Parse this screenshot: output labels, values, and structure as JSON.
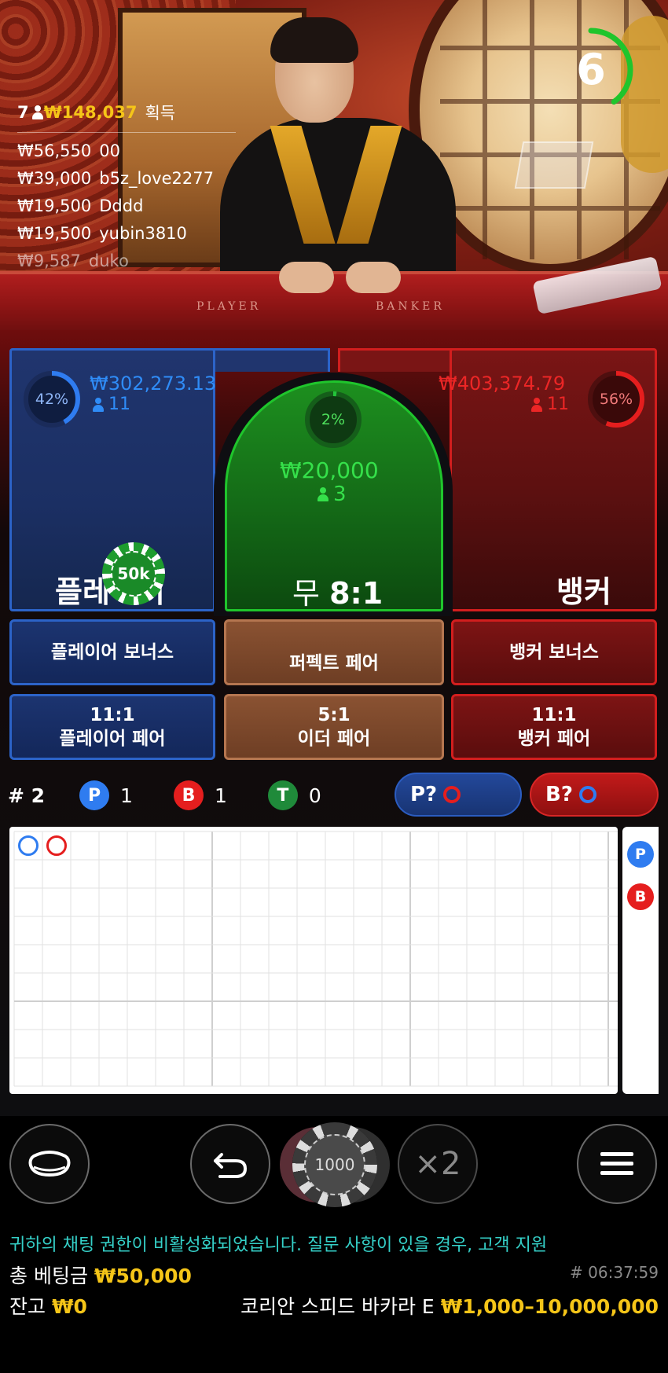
{
  "winners": {
    "count": "7",
    "total": "₩148,037",
    "suffix": "획득",
    "rows": [
      {
        "amount": "₩56,550",
        "name": "00"
      },
      {
        "amount": "₩39,000",
        "name": "b5z_love2277"
      },
      {
        "amount": "₩19,500",
        "name": "Dddd"
      },
      {
        "amount": "₩19,500",
        "name": "yubin3810"
      },
      {
        "amount": "₩9,587",
        "name": "duko"
      }
    ]
  },
  "timer": {
    "value": "6",
    "progress": 0.4
  },
  "table_labels": {
    "player": "PLAYER",
    "banker": "BANKER"
  },
  "bets": {
    "player": {
      "percent": "42%",
      "percent_value": 0.42,
      "amount": "₩302,273.13",
      "count": "11",
      "label": "플레이어"
    },
    "tie": {
      "percent": "2%",
      "percent_value": 0.02,
      "amount": "₩20,000",
      "count": "3",
      "label": "무",
      "odds": "8:1"
    },
    "banker": {
      "percent": "56%",
      "percent_value": 0.56,
      "amount": "₩403,374.79",
      "count": "11",
      "label": "뱅커"
    }
  },
  "placed_chip": "50k",
  "side_bets": {
    "player_bonus": "플레이어 보너스",
    "perfect_pair": "퍼펙트 페어",
    "banker_bonus": "뱅커 보너스",
    "player_pair": {
      "odds": "11:1",
      "label": "플레이어 페어"
    },
    "either_pair": {
      "odds": "5:1",
      "label": "이더 페어"
    },
    "banker_pair": {
      "odds": "11:1",
      "label": "뱅커 페어"
    }
  },
  "stats": {
    "round": "# 2",
    "p_letter": "P",
    "p_count": "1",
    "b_letter": "B",
    "b_count": "1",
    "t_letter": "T",
    "t_count": "0"
  },
  "predict": {
    "player": "P?",
    "banker": "B?"
  },
  "roadmap": {
    "results": [
      "player",
      "banker"
    ],
    "side_letters": [
      "P",
      "B"
    ]
  },
  "controls": {
    "chip_value": "1000",
    "double": "×2"
  },
  "footer": {
    "chat_notice": "귀하의 채팅 권한이 비활성화되었습니다. 질문 사항이 있을 경우, 고객 지원",
    "total_bet_label": "총 베팅금",
    "total_bet_value": "₩50,000",
    "timestamp": "# 06:37:59",
    "balance_label": "잔고",
    "balance_value": "₩0",
    "table_name": "코리안 스피드 바카라 E",
    "limits": "₩1,000–10,000,000"
  },
  "colors": {
    "player": "#2f7cf0",
    "banker": "#e51e1e",
    "tie": "#23c43a",
    "gold": "#f5c518"
  }
}
